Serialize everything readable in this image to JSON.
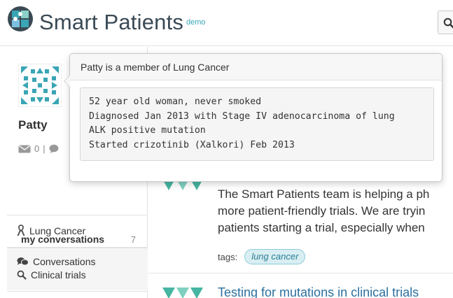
{
  "header": {
    "brand": "Smart Patients",
    "badge": "demo",
    "logo_icon": "puzzle-logo-icon",
    "search_icon": "search-icon"
  },
  "profile": {
    "name": "Patty",
    "message_count": "0",
    "separator": "|"
  },
  "sidebar": {
    "community": "Lung Cancer",
    "conversations_heading": "Conversations",
    "my_conversations": {
      "label": "my conversations",
      "count": "7"
    },
    "clinical_trials": "Clinical trials"
  },
  "popover": {
    "title": "Patty is a member of Lung Cancer",
    "lines": [
      "52 year old woman, never smoked",
      "Diagnosed Jan 2013 with Stage IV adenocarcinoma of lung",
      "ALK positive mutation",
      "Started crizotinib (Xalkori) Feb 2013"
    ]
  },
  "post": {
    "lines": [
      "The Smart Patients team is helping a ph",
      "more patient-friendly trials. We are tryin",
      "patients starting a trial, especially when"
    ],
    "tags_label": "tags:",
    "tag": "lung cancer"
  },
  "post2": {
    "title": "Testing for mutations in clinical trials"
  },
  "colors": {
    "accent_teal": "#3aa5b5",
    "link_blue": "#2b6f9e",
    "tag_bg": "#d9eef3"
  }
}
